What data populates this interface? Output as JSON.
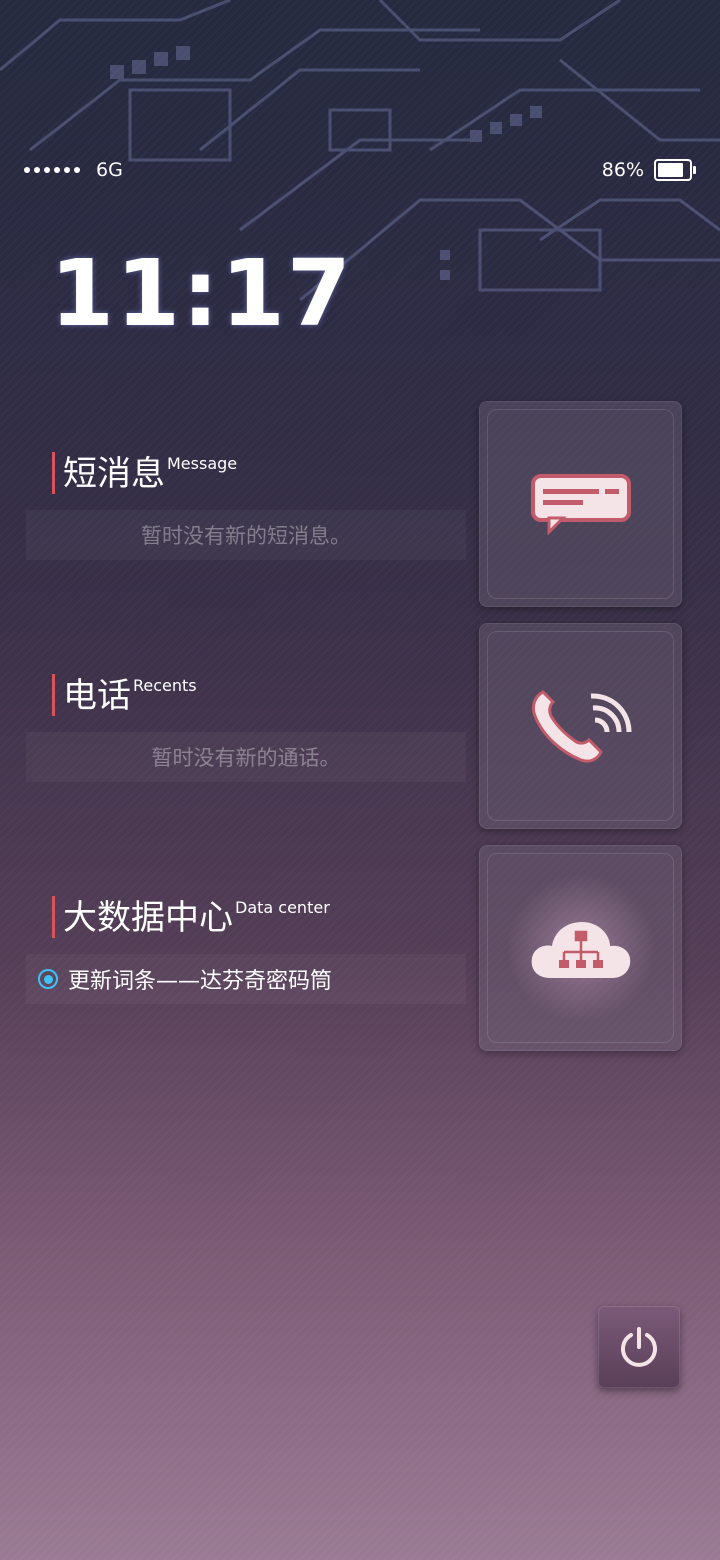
{
  "status": {
    "network": "6G",
    "battery": "86%",
    "battery_level": 0.86
  },
  "clock": {
    "time": "11:17"
  },
  "message": {
    "title_zh": "短消息",
    "title_en": "Message",
    "empty": "暂时没有新的短消息。"
  },
  "recents": {
    "title_zh": "电话",
    "title_en": "Recents",
    "empty": "暂时没有新的通话。"
  },
  "datacenter": {
    "title_zh": "大数据中心",
    "title_en": "Data  center",
    "item": "更新词条——达芬奇密码筒"
  },
  "icons": {
    "message": "message-icon",
    "phone": "phone-icon",
    "cloud": "cloud-network-icon",
    "power": "power-icon"
  },
  "colors": {
    "accent": "#d9535f",
    "radio": "#3ec2f5"
  }
}
